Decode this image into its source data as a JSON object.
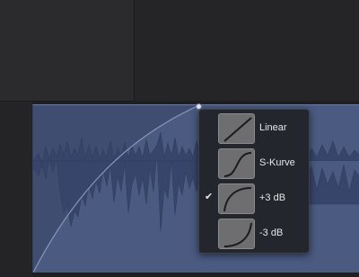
{
  "colors": {
    "region_fill": "#4a5a80",
    "waveform": "#3a4767",
    "menu_bg": "#24262d",
    "menu_text": "#e6e6e6"
  },
  "fade_curve_menu": {
    "items": [
      {
        "label": "Linear",
        "icon": "linear-curve-icon",
        "checked": false
      },
      {
        "label": "S-Kurve",
        "icon": "s-curve-icon",
        "checked": false
      },
      {
        "label": "+3 dB",
        "icon": "plus-3db-curve-icon",
        "checked": true,
        "check_glyph": "✔"
      },
      {
        "label": "-3 dB",
        "icon": "minus-3db-curve-icon",
        "checked": false
      }
    ]
  }
}
